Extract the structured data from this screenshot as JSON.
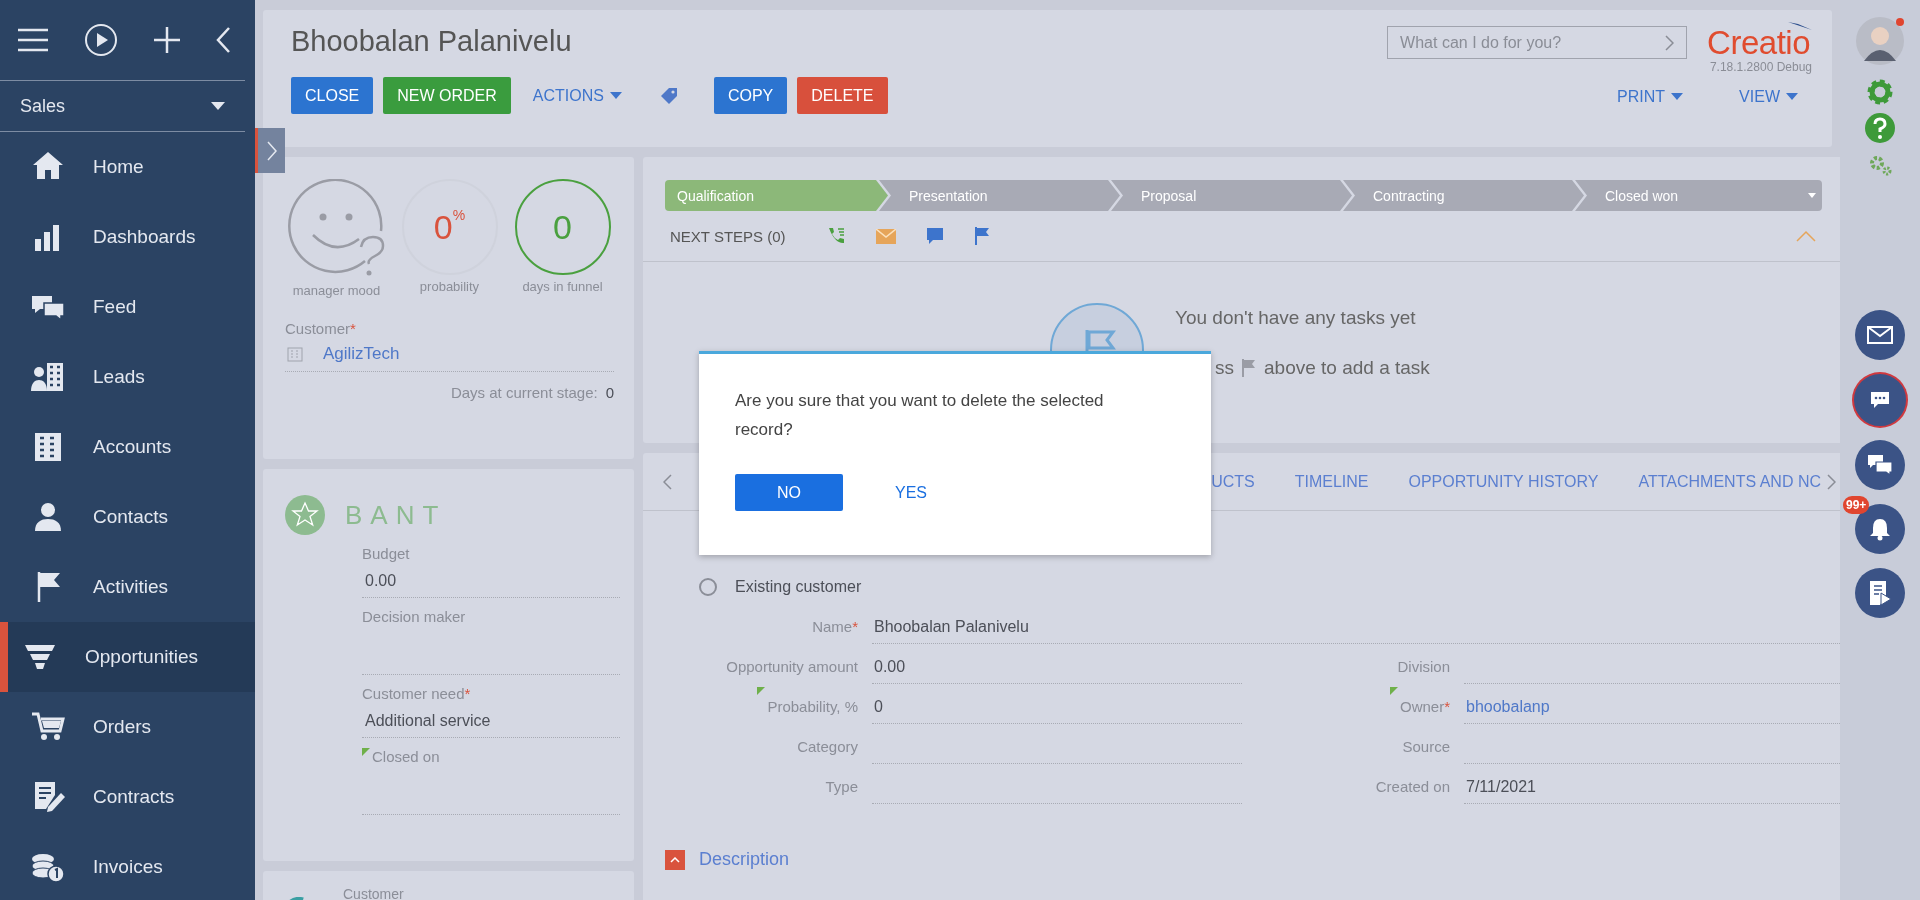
{
  "sidebar": {
    "section": "Sales",
    "items": [
      {
        "label": "Home",
        "selected": false
      },
      {
        "label": "Dashboards",
        "selected": false
      },
      {
        "label": "Feed",
        "selected": false
      },
      {
        "label": "Leads",
        "selected": false
      },
      {
        "label": "Accounts",
        "selected": false
      },
      {
        "label": "Contacts",
        "selected": false
      },
      {
        "label": "Activities",
        "selected": false
      },
      {
        "label": "Opportunities",
        "selected": true
      },
      {
        "label": "Orders",
        "selected": false
      },
      {
        "label": "Contracts",
        "selected": false
      },
      {
        "label": "Invoices",
        "selected": false
      }
    ]
  },
  "record": {
    "title": "Bhoobalan Palanivelu"
  },
  "actions": [
    {
      "label": "CLOSE",
      "kind": "primary"
    },
    {
      "label": "NEW ORDER",
      "kind": "success"
    },
    {
      "label": "ACTIONS",
      "kind": "menu"
    },
    {
      "label": "COPY",
      "kind": "primary"
    },
    {
      "label": "DELETE",
      "kind": "danger"
    }
  ],
  "search": {
    "placeholder": "What can I do for you?"
  },
  "logo": {
    "name": "Creatio",
    "version": "7.18.1.2800 Debug"
  },
  "view_menus": [
    "PRINT",
    "VIEW"
  ],
  "indicators": [
    {
      "kind": "mood",
      "label": "manager mood"
    },
    {
      "kind": "percent",
      "value": "0",
      "unit": "%",
      "label": "probability"
    },
    {
      "kind": "count",
      "value": "0",
      "label": "days in funnel"
    }
  ],
  "customer": {
    "label": "Customer",
    "required_mark": "*",
    "value": "AgilizTech"
  },
  "days_at_stage": {
    "label": "Days at current stage:",
    "value": "0"
  },
  "bant": {
    "title": "BANT",
    "fields": [
      {
        "label": "Budget",
        "corner_mark": false,
        "value": "0.00"
      },
      {
        "label": "Decision maker",
        "corner_mark": false
      },
      {
        "label": "Customer need",
        "required_mark": "*",
        "corner_mark": false,
        "value": "Additional service"
      },
      {
        "label": "Closed on",
        "corner_mark": true
      }
    ]
  },
  "third_card": {
    "label": "Customer"
  },
  "stages": [
    {
      "label": "Qualification",
      "selected": true
    },
    {
      "label": "Presentation",
      "selected": false
    },
    {
      "label": "Proposal",
      "selected": false
    },
    {
      "label": "Contracting",
      "selected": false
    },
    {
      "label": "Closed won",
      "selected": false
    }
  ],
  "next_steps": {
    "label": "NEXT STEPS (0)",
    "expanded": true
  },
  "empty_tasks": {
    "title": "You don't have any tasks yet",
    "hint_before": "ss",
    "hint_after": "above to add a task"
  },
  "tabs": [
    {
      "label": "UCTS",
      "selected": false
    },
    {
      "label": "TIMELINE",
      "selected": false
    },
    {
      "label": "OPPORTUNITY HISTORY",
      "selected": false
    },
    {
      "label": "ATTACHMENTS AND NC",
      "selected": false
    }
  ],
  "customer_type": {
    "label": "Existing customer",
    "selected": false
  },
  "name_field": {
    "label": "Name",
    "required_mark": "*",
    "corner_mark": false,
    "value": "Bhoobalan Palanivelu"
  },
  "fields_left": [
    {
      "label": "Opportunity amount",
      "corner_mark": false,
      "value": "0.00"
    },
    {
      "label": "Probability, %",
      "corner_mark": true,
      "value": "0"
    },
    {
      "label": "Category",
      "corner_mark": false
    },
    {
      "label": "Type",
      "corner_mark": false
    }
  ],
  "fields_right": [
    {
      "label": "Division",
      "corner_mark": false,
      "kind": "text"
    },
    {
      "label": "Owner",
      "required_mark": "*",
      "corner_mark": true,
      "kind": "link",
      "value": "bhoobalanp"
    },
    {
      "label": "Source",
      "corner_mark": false,
      "kind": "text"
    },
    {
      "label": "Created on",
      "corner_mark": false,
      "kind": "text",
      "value": "7/11/2021"
    }
  ],
  "description": {
    "label": "Description",
    "expanded": true
  },
  "rail": {
    "notifications": "99+"
  },
  "dialog": {
    "message": "Are you sure that you want to delete the selected record?",
    "buttons": [
      {
        "label": "NO",
        "kind": "primary"
      },
      {
        "label": "YES",
        "kind": "link"
      }
    ]
  }
}
